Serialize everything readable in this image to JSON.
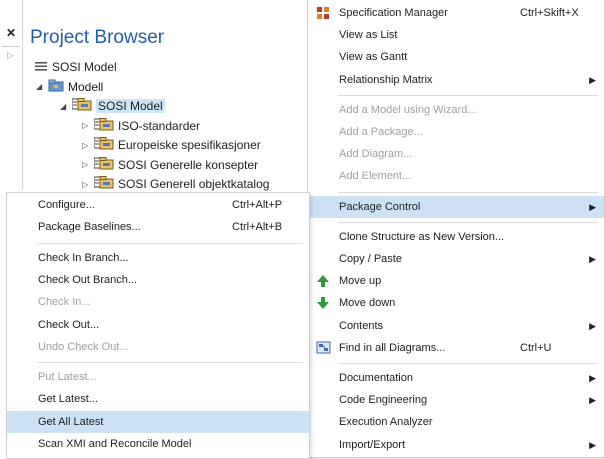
{
  "left_panel": {
    "close_glyph": "✕"
  },
  "project_browser": {
    "title": "Project Browser",
    "tree": [
      {
        "label": "SOSI Model",
        "level": 0,
        "icon": "hamburger-icon"
      },
      {
        "label": "Modell",
        "level": 1,
        "icon": "model-folder-icon",
        "expanded": true
      },
      {
        "label": "SOSI Model",
        "level": 2,
        "icon": "package-icon",
        "expanded": true,
        "selected": true
      },
      {
        "label": "ISO-standarder",
        "level": 3,
        "icon": "package-icon"
      },
      {
        "label": "Europeiske spesifikasjoner",
        "level": 3,
        "icon": "package-icon"
      },
      {
        "label": "SOSI Generelle konsepter",
        "level": 3,
        "icon": "package-icon"
      },
      {
        "label": "SOSI Generell objektkatalog",
        "level": 3,
        "icon": "package-icon"
      }
    ]
  },
  "main_menu": {
    "items": [
      {
        "label": "Specification Manager",
        "shortcut": "Ctrl+Skift+X",
        "icon": "specification-manager-icon"
      },
      {
        "label": "View as List"
      },
      {
        "label": "View as Gantt"
      },
      {
        "label": "Relationship Matrix",
        "submenu": true
      },
      {
        "separator": true
      },
      {
        "label": "Add a Model using Wizard...",
        "disabled": true
      },
      {
        "label": "Add a Package...",
        "disabled": true
      },
      {
        "label": "Add Diagram...",
        "disabled": true
      },
      {
        "label": "Add Element...",
        "disabled": true
      },
      {
        "separator": true
      },
      {
        "label": "Package Control",
        "submenu": true,
        "highlighted": true
      },
      {
        "separator": true
      },
      {
        "label": "Clone Structure as New Version..."
      },
      {
        "label": "Copy / Paste",
        "submenu": true
      },
      {
        "label": "Move up",
        "icon": "arrow-up-icon"
      },
      {
        "label": "Move down",
        "icon": "arrow-down-icon"
      },
      {
        "label": "Contents",
        "submenu": true
      },
      {
        "label": "Find in all Diagrams...",
        "shortcut": "Ctrl+U",
        "icon": "find-diagrams-icon"
      },
      {
        "separator": true
      },
      {
        "label": "Documentation",
        "submenu": true
      },
      {
        "label": "Code Engineering",
        "submenu": true
      },
      {
        "label": "Execution Analyzer"
      },
      {
        "label": "Import/Export",
        "submenu": true
      }
    ]
  },
  "package_control_menu": {
    "items": [
      {
        "label": "Configure...",
        "shortcut": "Ctrl+Alt+P"
      },
      {
        "label": "Package Baselines...",
        "shortcut": "Ctrl+Alt+B"
      },
      {
        "separator": true
      },
      {
        "label": "Check In Branch..."
      },
      {
        "label": "Check Out Branch..."
      },
      {
        "label": "Check In...",
        "disabled": true
      },
      {
        "label": "Check Out..."
      },
      {
        "label": "Undo Check Out...",
        "disabled": true
      },
      {
        "separator": true
      },
      {
        "label": "Put Latest...",
        "disabled": true
      },
      {
        "label": "Get Latest..."
      },
      {
        "label": "Get All Latest",
        "highlighted": true
      },
      {
        "label": "Scan XMI and Reconcile Model"
      }
    ]
  }
}
